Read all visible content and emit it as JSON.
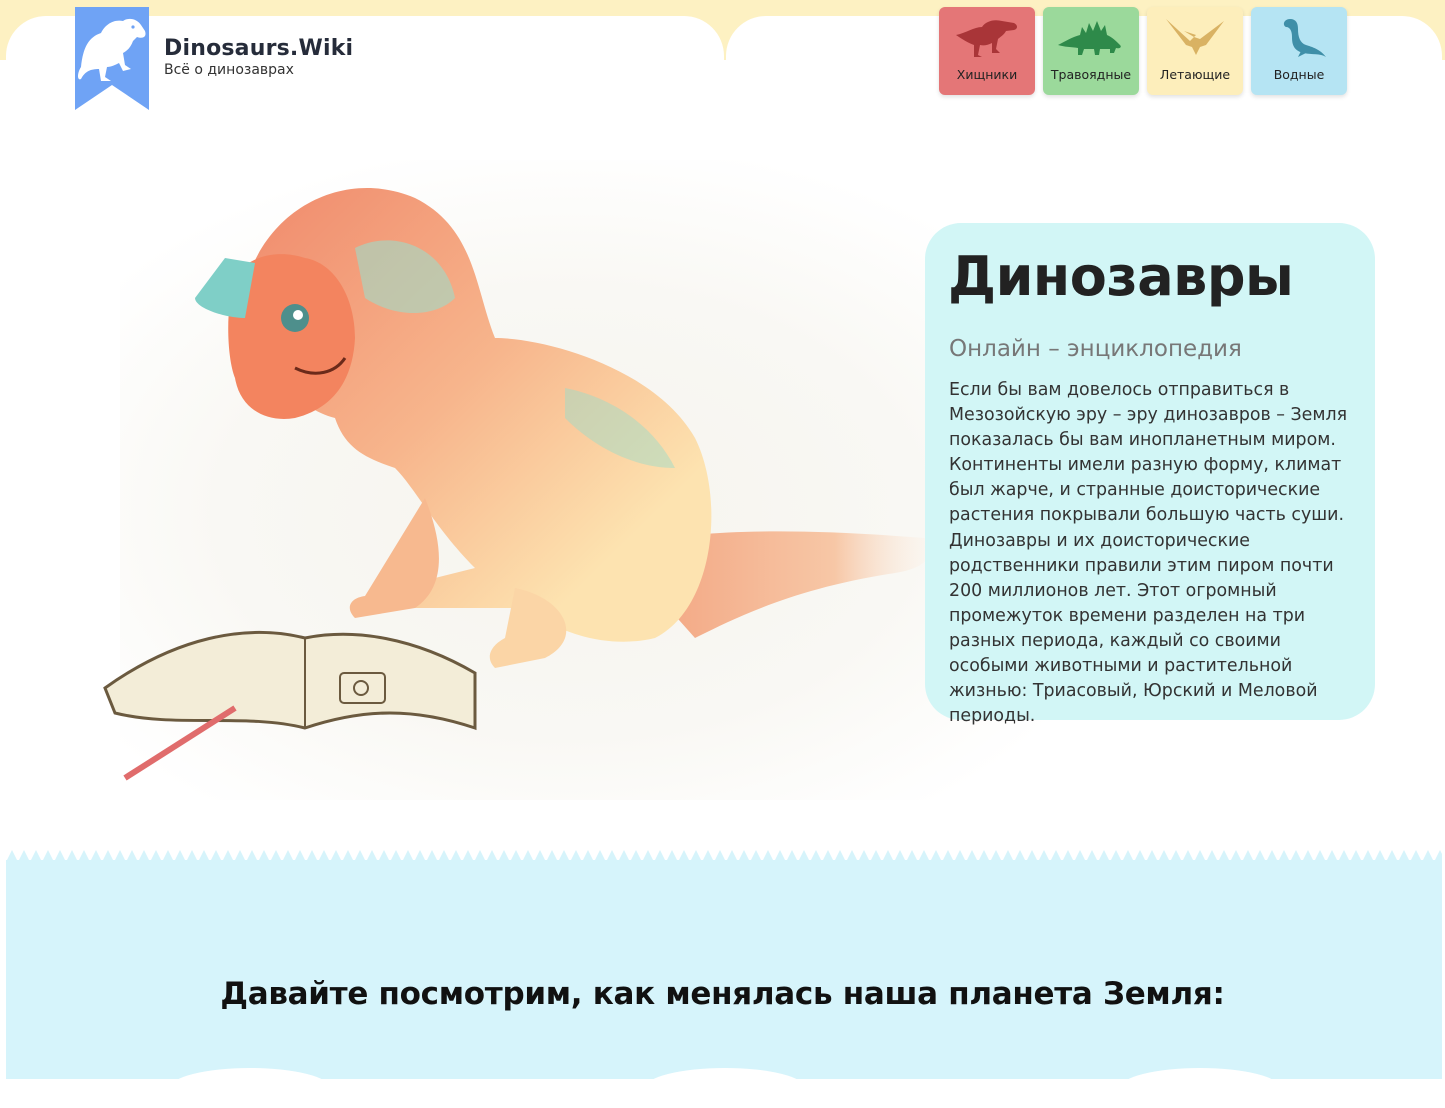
{
  "header": {
    "brand_title": "Dinosaurs.Wiki",
    "brand_subtitle": "Всё о динозаврах",
    "nav": [
      {
        "label": "Хищники",
        "color": "#e47677",
        "icon": "trex-icon"
      },
      {
        "label": "Травоядные",
        "color": "#9bd99b",
        "icon": "stegosaurus-icon"
      },
      {
        "label": "Летающие",
        "color": "#fdeebb",
        "icon": "pterodactyl-icon"
      },
      {
        "label": "Водные",
        "color": "#b5e4f3",
        "icon": "plesiosaur-icon"
      }
    ]
  },
  "hero": {
    "title": "Динозавры",
    "subtitle": "Онлайн – энциклопедия",
    "body": "Если бы вам довелось отправиться в Мезозойскую эру – эру динозавров – Земля показалась бы вам инопланетным миром. Континенты имели разную форму, климат был жарче, и странные доисторические растения покрывали большую часть суши. Динозавры и их доисторические родственники правили этим пиром почти 200 миллионов лет. Этот огромный промежуток времени разделен на три разных периода, каждый со своими особыми животными и растительной жизнью: Триасовый, Юрский и Меловой периоды."
  },
  "section": {
    "heading": "Давайте посмотрим, как менялась наша планета Земля:"
  },
  "colors": {
    "top_band": "#fdf1c2",
    "card_bg": "#d2f6f6",
    "section_bg": "#d6f4fb",
    "logo_blue": "#6fa3f5"
  }
}
